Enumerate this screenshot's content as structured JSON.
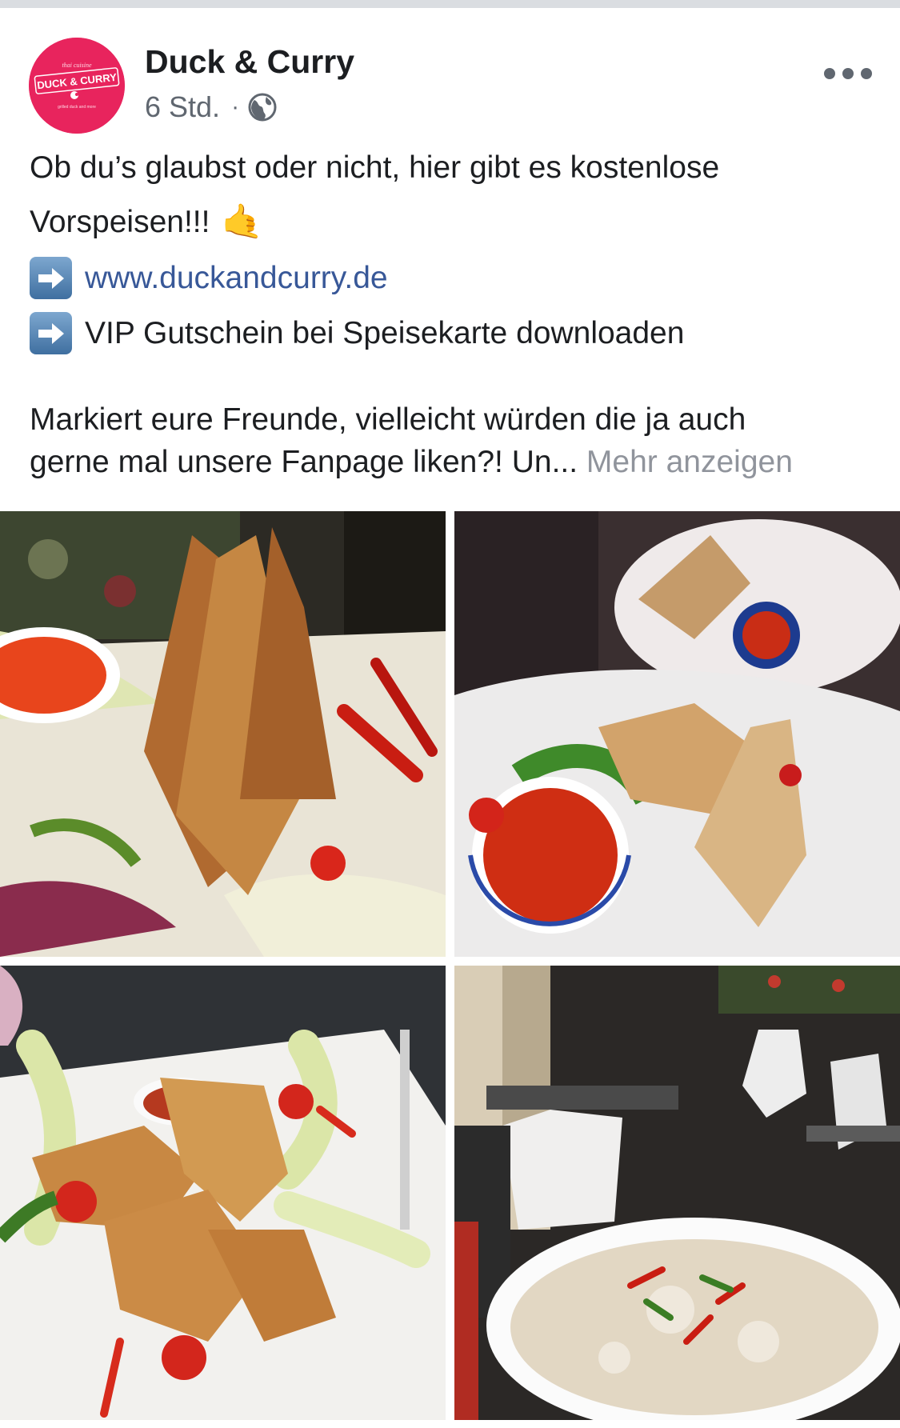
{
  "post": {
    "page_name": "Duck & Curry",
    "time": "6 Std.",
    "separator": "·",
    "privacy_icon": "globe-icon",
    "more_icon": "more-options-icon",
    "logo": {
      "name": "duck-and-curry-logo",
      "text": "DUCK & CURRY",
      "tagline_top": "thai cuisine",
      "tagline_bottom": "grilled duck and more"
    },
    "text_lines": {
      "line1": "Ob du’s glaubst oder nicht, hier gibt es kostenlose",
      "line2": "Vorspeisen!!!",
      "line2_emoji": "🤙",
      "link": "www.duckandcurry.de",
      "line4": "VIP Gutschein bei Speisekarte downloaden",
      "line5": "Markiert eure Freunde, vielleicht würden die ja auch",
      "line6": "gerne mal unsere Fanpage liken?! Un...",
      "see_more": "Mehr anzeigen"
    },
    "arrow_icon": "right-arrow-icon"
  },
  "photos": [
    "spring-rolls-plate-photo",
    "spring-rolls-two-plates-photo",
    "fried-wontons-photo",
    "restaurant-terrace-soup-photo"
  ],
  "colors": {
    "brand": "#e8245d",
    "link": "#385898",
    "secondary_text": "#606770",
    "see_more": "#90949c"
  }
}
